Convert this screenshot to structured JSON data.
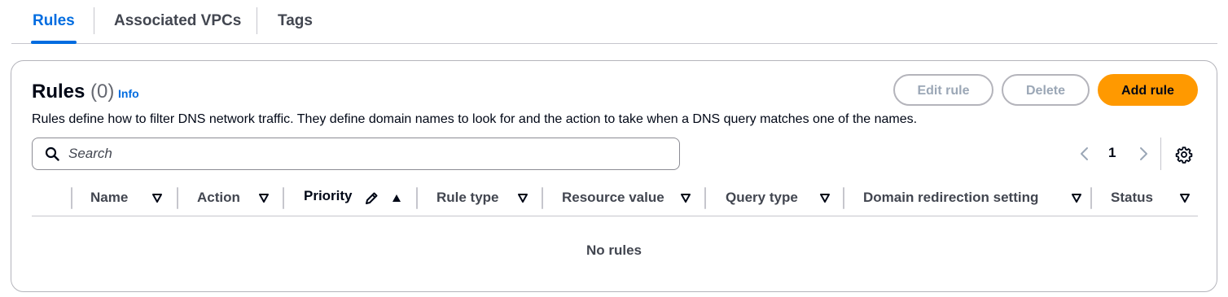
{
  "tabs": [
    {
      "label": "Rules",
      "active": true
    },
    {
      "label": "Associated VPCs",
      "active": false
    },
    {
      "label": "Tags",
      "active": false
    }
  ],
  "panel": {
    "title": "Rules",
    "count": "(0)",
    "info": "Info",
    "description": "Rules define how to filter DNS network traffic. They define domain names to look for and the action to take when a DNS query matches one of the names."
  },
  "buttons": {
    "edit_rule": "Edit rule",
    "delete": "Delete",
    "add_rule": "Add rule"
  },
  "search": {
    "placeholder": "Search",
    "value": ""
  },
  "pagination": {
    "current_page": "1"
  },
  "table": {
    "columns": [
      {
        "label": "Name",
        "sort": "none"
      },
      {
        "label": "Action",
        "sort": "none"
      },
      {
        "label": "Priority",
        "sort": "ascending",
        "editable": true
      },
      {
        "label": "Rule type",
        "sort": "none"
      },
      {
        "label": "Resource value",
        "sort": "none"
      },
      {
        "label": "Query type",
        "sort": "none"
      },
      {
        "label": "Domain redirection setting",
        "sort": "none"
      },
      {
        "label": "Status",
        "sort": "none"
      }
    ],
    "empty_message": "No rules"
  },
  "colors": {
    "accent": "#006ce0",
    "primary_button": "#ff9900",
    "text": "#000716",
    "muted_text": "#424650",
    "border": "#c6c6cd"
  },
  "icons": [
    "search-icon",
    "chevron-left-icon",
    "chevron-right-icon",
    "settings-icon",
    "sort-down-icon",
    "sort-up-icon",
    "pencil-icon"
  ]
}
